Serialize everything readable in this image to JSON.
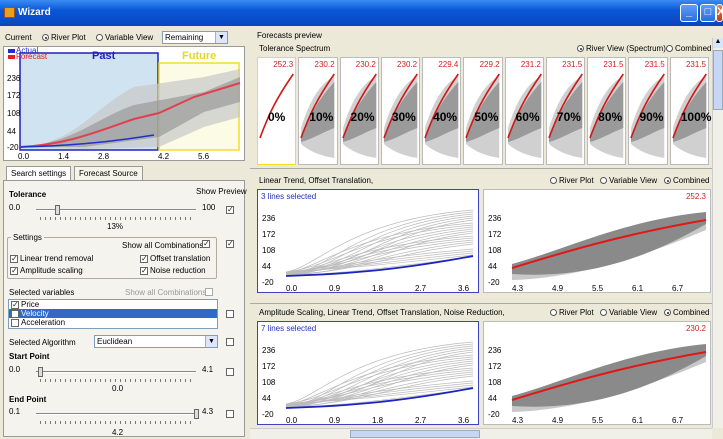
{
  "window": {
    "title": "Wizard",
    "min": "_",
    "max": "□",
    "close": "X"
  },
  "current": {
    "label": "Current",
    "options": [
      "River Plot",
      "Variable View"
    ],
    "selected": "River Plot",
    "combo_value": "Remaining"
  },
  "main_chart": {
    "legend_actual": "Actual",
    "legend_forecast": "Forecast",
    "past_label": "Past",
    "future_label": "Future",
    "yticks": [
      "236",
      "172",
      "108",
      "44",
      "-20"
    ],
    "xticks": [
      "0.0",
      "1.4",
      "2.8",
      "4.2",
      "5.6"
    ]
  },
  "tabs": [
    "Search settings",
    "Forecast Source"
  ],
  "tolerance": {
    "label": "Tolerance",
    "show_preview": "Show Preview",
    "min": "0.0",
    "max": "100",
    "value": "13%",
    "value_num": 13
  },
  "settings": {
    "label": "Settings",
    "show_all": "Show all Combinations",
    "items": [
      {
        "label": "Linear trend removal",
        "checked": true
      },
      {
        "label": "Offset translation",
        "checked": true
      },
      {
        "label": "Amplitude scaling",
        "checked": true
      },
      {
        "label": "Noise reduction",
        "checked": true
      }
    ]
  },
  "selected_variables": {
    "label": "Selected variables",
    "show_all": "Show all Combinations",
    "items": [
      {
        "label": "Price",
        "checked": true,
        "selected": false
      },
      {
        "label": "Velocity",
        "checked": false,
        "selected": true
      },
      {
        "label": "Acceleration",
        "checked": false,
        "selected": false
      }
    ]
  },
  "algorithm": {
    "label": "Selected Algorithm",
    "value": "Euclidean"
  },
  "start_point": {
    "label": "Start Point",
    "min": "0.0",
    "max": "4.1",
    "value": "0.0"
  },
  "end_point": {
    "label": "End Point",
    "min": "0.1",
    "max": "4.3",
    "value": "4.2"
  },
  "preview": {
    "title": "Forecasts preview",
    "spectrum_title": "Tolerance Spectrum",
    "spectrum_options": [
      "River View (Spectrum)",
      "Combined"
    ],
    "spectrum_selected": "River View (Spectrum)"
  },
  "spectrum": [
    {
      "pct": "0%",
      "val": "252.3"
    },
    {
      "pct": "10%",
      "val": "230.2"
    },
    {
      "pct": "20%",
      "val": "230.2"
    },
    {
      "pct": "30%",
      "val": "230.2"
    },
    {
      "pct": "40%",
      "val": "229.4"
    },
    {
      "pct": "50%",
      "val": "229.2"
    },
    {
      "pct": "60%",
      "val": "231.2"
    },
    {
      "pct": "70%",
      "val": "231.5"
    },
    {
      "pct": "80%",
      "val": "231.5"
    },
    {
      "pct": "90%",
      "val": "231.5"
    },
    {
      "pct": "100%",
      "val": "231.5"
    }
  ],
  "row1": {
    "title": "Linear Trend, Offset Translation,",
    "options": [
      "River Plot",
      "Variable View",
      "Combined"
    ],
    "selected": "Combined",
    "lines": "3 lines selected",
    "value": "252.3",
    "yticks": [
      "236",
      "172",
      "108",
      "44",
      "-20"
    ],
    "xticks_left": [
      "0.0",
      "0.9",
      "1.8",
      "2.7",
      "3.6"
    ],
    "xticks_right": [
      "4.3",
      "4.9",
      "5.5",
      "6.1",
      "6.7"
    ]
  },
  "row2": {
    "title": "Amplitude Scaling, Linear Trend, Offset Translation, Noise Reduction,",
    "options": [
      "River Plot",
      "Variable View",
      "Combined"
    ],
    "selected": "Combined",
    "lines": "7 lines selected",
    "value": "230.2",
    "yticks": [
      "236",
      "172",
      "108",
      "44",
      "-20"
    ],
    "xticks_left": [
      "0.0",
      "0.9",
      "1.8",
      "2.7",
      "3.6"
    ],
    "xticks_right": [
      "4.3",
      "4.9",
      "5.5",
      "6.1",
      "6.7"
    ]
  },
  "colors": {
    "accent": "#316ac5",
    "forecast": "#e02020",
    "actual": "#2030d0",
    "past_border": "#2020c0",
    "future_border": "#f0e020"
  }
}
